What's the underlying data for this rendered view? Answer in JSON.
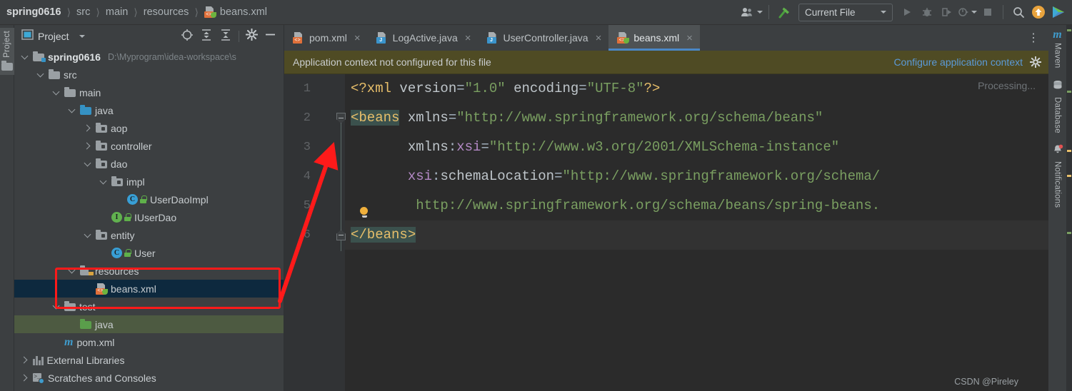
{
  "breadcrumb": {
    "items": [
      "spring0616",
      "src",
      "main",
      "resources"
    ],
    "file": "beans.xml",
    "file_icon": "spring-xml-file-icon"
  },
  "toolbar": {
    "icons": [
      "user-settings-icon",
      "build-hammer-icon"
    ],
    "run_config": "Current File",
    "run_label": "run-icon",
    "debug_label": "debug-icon",
    "coverage_label": "run-with-coverage-icon",
    "profiler_label": "profiler-icon",
    "stop_label": "stop-icon",
    "search_label": "search-icon",
    "update_label": "update-project-icon",
    "ide_label": "ide-play-icon"
  },
  "left_strip": {
    "project_tab": "Project"
  },
  "right_strip": {
    "items": [
      {
        "label": "Maven",
        "icon": "maven-icon"
      },
      {
        "label": "Database",
        "icon": "database-icon"
      },
      {
        "label": "Notifications",
        "icon": "notifications-bell-icon"
      }
    ]
  },
  "project_panel": {
    "title": "Project",
    "actions": [
      "locate-target-icon",
      "expand-all-icon",
      "collapse-all-icon",
      "settings-gear-icon",
      "hide-minimize-icon"
    ],
    "tree": [
      {
        "indent": 0,
        "twisty": "down",
        "icon": "module-folder",
        "label": "spring0616",
        "bold": true,
        "path": "D:\\Myprogram\\idea-workspace\\s"
      },
      {
        "indent": 1,
        "twisty": "down",
        "icon": "folder-gray",
        "label": "src"
      },
      {
        "indent": 2,
        "twisty": "down",
        "icon": "folder-gray",
        "label": "main"
      },
      {
        "indent": 3,
        "twisty": "down",
        "icon": "folder-blue",
        "label": "java"
      },
      {
        "indent": 4,
        "twisty": "right",
        "icon": "package",
        "label": "aop"
      },
      {
        "indent": 4,
        "twisty": "right",
        "icon": "package",
        "label": "controller"
      },
      {
        "indent": 4,
        "twisty": "down",
        "icon": "package",
        "label": "dao"
      },
      {
        "indent": 5,
        "twisty": "down",
        "icon": "package",
        "label": "impl"
      },
      {
        "indent": 6,
        "twisty": "none",
        "icon": "class",
        "label": "UserDaoImpl"
      },
      {
        "indent": 5,
        "twisty": "none",
        "icon": "interface",
        "label": "IUserDao"
      },
      {
        "indent": 4,
        "twisty": "down",
        "icon": "package",
        "label": "entity"
      },
      {
        "indent": 5,
        "twisty": "none",
        "icon": "class",
        "label": "User"
      },
      {
        "indent": 3,
        "twisty": "down",
        "icon": "folder-resources",
        "label": "resources"
      },
      {
        "indent": 4,
        "twisty": "none",
        "icon": "spring-xml",
        "label": "beans.xml",
        "selected": true
      },
      {
        "indent": 2,
        "twisty": "down",
        "icon": "folder-gray",
        "label": "test"
      },
      {
        "indent": 3,
        "twisty": "none",
        "icon": "folder-green",
        "label": "java",
        "test_root": true
      },
      {
        "indent": 2,
        "twisty": "none",
        "icon": "maven-pom",
        "label": "pom.xml"
      },
      {
        "indent": 0,
        "twisty": "right",
        "icon": "libraries",
        "label": "External Libraries"
      },
      {
        "indent": 0,
        "twisty": "right",
        "icon": "scratches",
        "label": "Scratches and Consoles"
      }
    ]
  },
  "editor": {
    "tabs": [
      {
        "label": "pom.xml",
        "icon": "xml-file-icon",
        "active": false
      },
      {
        "label": "LogActive.java",
        "icon": "java-file-icon",
        "active": false
      },
      {
        "label": "UserController.java",
        "icon": "java-file-icon",
        "active": false
      },
      {
        "label": "beans.xml",
        "icon": "spring-xml-file-icon",
        "active": true
      }
    ],
    "more_tabs_icon": "more-options-icon",
    "notification": {
      "message": "Application context not configured for this file",
      "link": "Configure application context",
      "gear": "notification-settings-icon"
    },
    "processing_hint": "Processing...",
    "line_numbers": [
      "1",
      "2",
      "3",
      "4",
      "5",
      "6"
    ],
    "code_lines": [
      {
        "n": 1,
        "segments": [
          {
            "t": "<?xml",
            "c": "proc"
          },
          {
            "t": " ",
            "c": "plain"
          },
          {
            "t": "version",
            "c": "attr"
          },
          {
            "t": "=",
            "c": "plain"
          },
          {
            "t": "\"1.0\"",
            "c": "val"
          },
          {
            "t": " ",
            "c": "plain"
          },
          {
            "t": "encoding",
            "c": "attr"
          },
          {
            "t": "=",
            "c": "plain"
          },
          {
            "t": "\"UTF-8\"",
            "c": "val"
          },
          {
            "t": "?>",
            "c": "proc"
          }
        ]
      },
      {
        "n": 2,
        "segments": [
          {
            "t": "<beans",
            "c": "tag-match"
          },
          {
            "t": " ",
            "c": "plain"
          },
          {
            "t": "xmlns",
            "c": "attr"
          },
          {
            "t": "=",
            "c": "plain"
          },
          {
            "t": "\"http://www.springframework.org/schema/beans\"",
            "c": "val"
          }
        ]
      },
      {
        "n": 3,
        "segments": [
          {
            "t": "       ",
            "c": "plain"
          },
          {
            "t": "xmlns",
            "c": "attr"
          },
          {
            "t": ":",
            "c": "plain"
          },
          {
            "t": "xsi",
            "c": "ns"
          },
          {
            "t": "=",
            "c": "plain"
          },
          {
            "t": "\"http://www.w3.org/2001/XMLSchema-instance\"",
            "c": "val"
          }
        ]
      },
      {
        "n": 4,
        "segments": [
          {
            "t": "       ",
            "c": "plain"
          },
          {
            "t": "xsi",
            "c": "ns"
          },
          {
            "t": ":",
            "c": "plain"
          },
          {
            "t": "schemaLocation",
            "c": "attr"
          },
          {
            "t": "=",
            "c": "plain"
          },
          {
            "t": "\"http://www.springframework.org/schema/",
            "c": "val"
          }
        ]
      },
      {
        "n": 5,
        "segments": [
          {
            "t": "        ",
            "c": "plain"
          },
          {
            "t": "http://www.springframework.org/schema/beans/spring-beans.",
            "c": "val"
          }
        ]
      },
      {
        "n": 6,
        "current": true,
        "segments": [
          {
            "t": "</beans>",
            "c": "tag-match"
          }
        ]
      }
    ],
    "fold_markers": [
      {
        "line": 2,
        "type": "top"
      },
      {
        "line": 6,
        "type": "bottom"
      }
    ],
    "intention_bulb": {
      "line": 5,
      "icon": "intention-bulb-icon"
    }
  },
  "annotations": {
    "highlight_box": {
      "label": "resources-beans-highlight"
    },
    "arrow": {
      "label": "pointer-arrow",
      "color": "#ff1a1a"
    }
  },
  "watermark": "CSDN @Pireley",
  "colors": {
    "accent_blue": "#4a88c7",
    "annotation_red": "#ff1a1a",
    "notification_bg": "#4f4b24",
    "selection_blue": "#0d293e",
    "test_root_green": "#4d5a41",
    "editor_bg": "#2b2b2b"
  }
}
